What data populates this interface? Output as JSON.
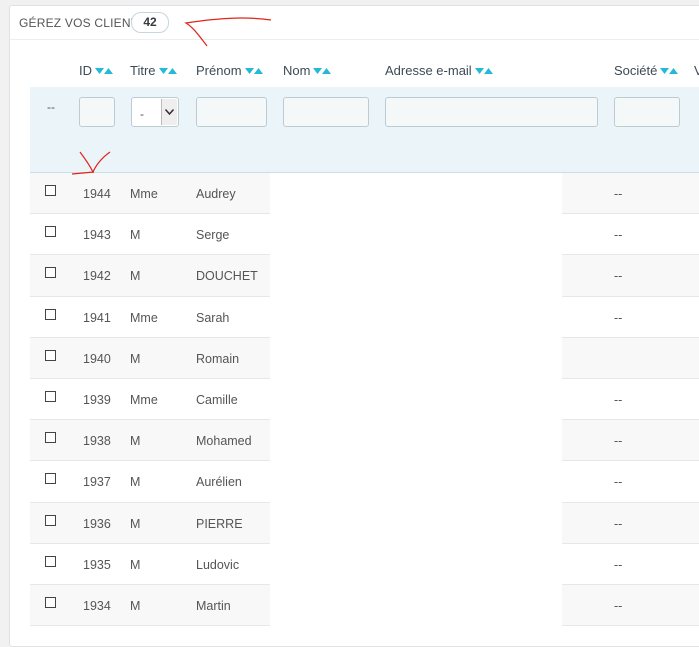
{
  "panel": {
    "title": "Gérez vos clients",
    "count": "42"
  },
  "columns": {
    "id": "ID",
    "titre": "Titre",
    "prenom": "Prénom",
    "nom": "Nom",
    "email": "Adresse e-mail",
    "societe": "Société",
    "next": "V"
  },
  "filters": {
    "select_all": "--",
    "titre_selected": "-"
  },
  "rows": [
    {
      "id": "1944",
      "titre": "Mme",
      "prenom": "Audrey",
      "societe": "--"
    },
    {
      "id": "1943",
      "titre": "M",
      "prenom": "Serge",
      "societe": "--"
    },
    {
      "id": "1942",
      "titre": "M",
      "prenom": "DOUCHET",
      "societe": "--"
    },
    {
      "id": "1941",
      "titre": "Mme",
      "prenom": "Sarah",
      "societe": "--"
    },
    {
      "id": "1940",
      "titre": "M",
      "prenom": "Romain",
      "societe": ""
    },
    {
      "id": "1939",
      "titre": "Mme",
      "prenom": "Camille",
      "societe": "--"
    },
    {
      "id": "1938",
      "titre": "M",
      "prenom": "Mohamed",
      "societe": "--"
    },
    {
      "id": "1937",
      "titre": "M",
      "prenom": "Aurélien",
      "societe": "--"
    },
    {
      "id": "1936",
      "titre": "M",
      "prenom": "PIERRE",
      "societe": "--"
    },
    {
      "id": "1935",
      "titre": "M",
      "prenom": "Ludovic",
      "societe": "--"
    },
    {
      "id": "1934",
      "titre": "M",
      "prenom": "Martin",
      "societe": "--"
    }
  ],
  "colors": {
    "accent": "#25b9d7",
    "filter_bg": "#eaf4f9",
    "annotation": "#e0251b"
  }
}
